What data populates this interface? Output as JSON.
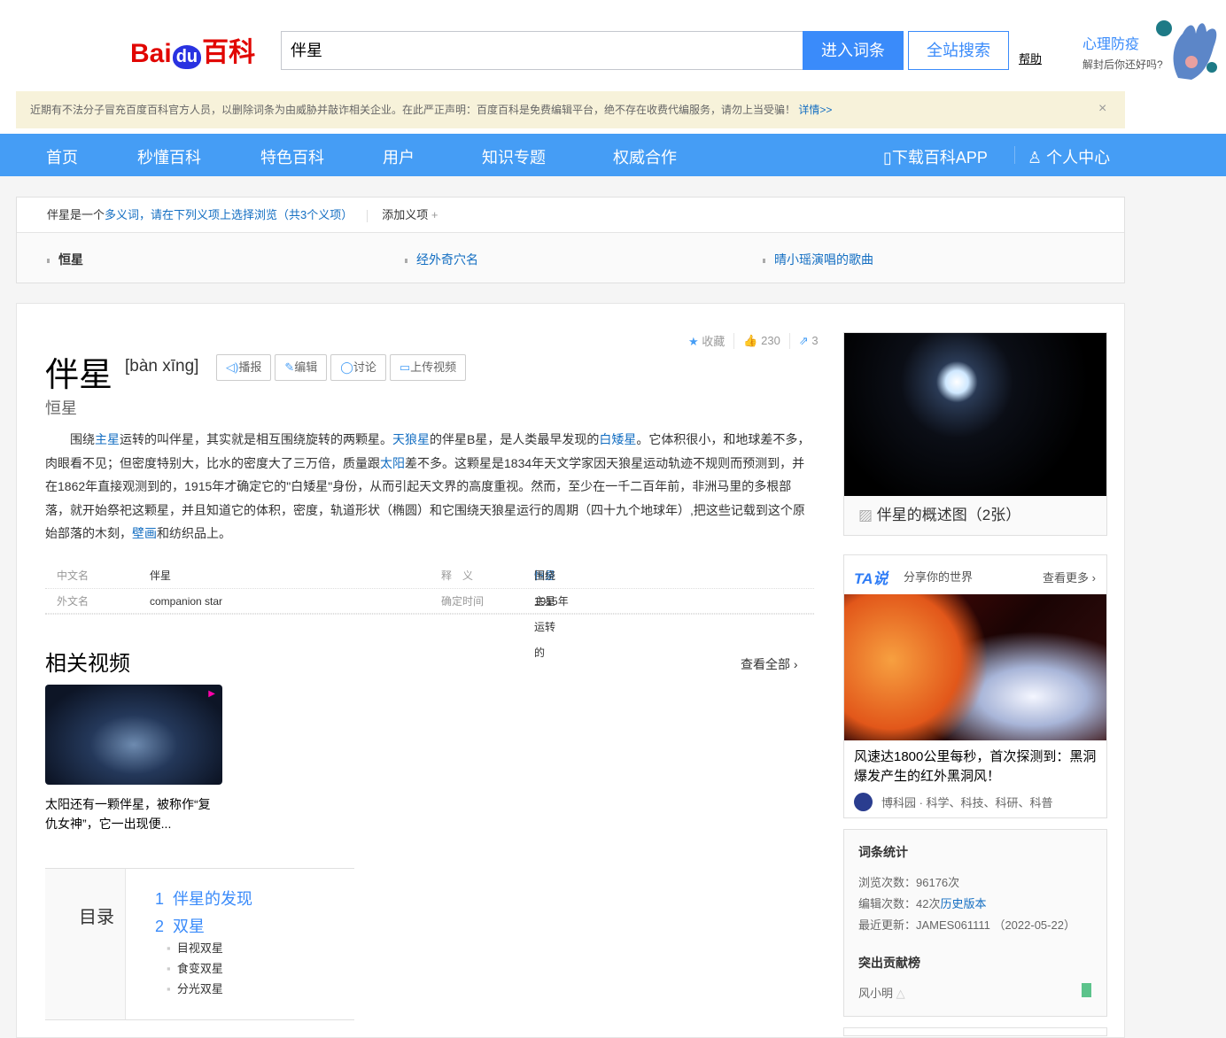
{
  "header": {
    "logo_text": "Baidu百科",
    "logo_parts": [
      "Bai",
      "du",
      "百科"
    ],
    "search_value": "伴星",
    "enter_button": "进入词条",
    "site_search_button": "全站搜索",
    "help_link": "帮助",
    "promo_title": "心理防疫",
    "promo_subtitle": "解封后你还好吗?"
  },
  "notice": {
    "text": "近期有不法分子冒充百度百科官方人员，以删除词条为由威胁并敲诈相关企业。在此严正声明：百度百科是免费编辑平台，绝不存在收费代编服务，请勿上当受骗！",
    "link": "详情>>",
    "close": "×"
  },
  "nav": {
    "items": [
      "首页",
      "秒懂百科",
      "特色百科",
      "用户",
      "知识专题",
      "权威合作"
    ],
    "app": "下载百科APP",
    "personal": "个人中心"
  },
  "polysemy": {
    "term": "伴星",
    "pre": "是一个",
    "link": "多义词",
    "mid": "，请在下列义项上选择浏览（共3个义项）",
    "add": "添加义项",
    "add_icon": "+",
    "items": [
      "恒星",
      "经外奇穴名",
      "晴小瑶演唱的歌曲"
    ]
  },
  "entry": {
    "title": "伴星",
    "pinyin": "[bàn xīng]",
    "subtitle": "恒星",
    "tools": [
      "播报",
      "编辑",
      "讨论",
      "上传视频"
    ],
    "collect": "收藏",
    "likes": "230",
    "shares": "3",
    "para": [
      {
        "t": "围绕"
      },
      {
        "l": "主星"
      },
      {
        "t": "运转的叫伴星，其实就是相互围绕旋转的两颗星。"
      },
      {
        "l": "天狼星"
      },
      {
        "t": "的伴星B星，是人类最早发现的"
      },
      {
        "l": "白矮星"
      },
      {
        "t": "。它体积很小，和地球差不多，肉眼看不见；但密度特别大，比水的密度大了三万倍，质量跟"
      },
      {
        "l": "太阳"
      },
      {
        "t": "差不多。这颗星是1834年天文学家因天狼星运动轨迹不规则而预测到，并在1862年直接观测到的，1915年才确定它的\"白矮星\"身份，从而引起天文界的高度重视。然而，至少在一千二百年前，非洲马里的多根部落，就开始祭祀这颗星，并且知道它的体积，密度，轨道形状（椭圆）和它围绕天狼星运行的周期（四十九个地球年）,把这些记载到这个原始部落的木刻，"
      },
      {
        "l": "壁画"
      },
      {
        "t": "和纺织品上。"
      }
    ],
    "info": [
      {
        "k": "中文名",
        "v": "伴星",
        "k2": "释　义",
        "v2": "围绕主星运转的",
        "v2link": "恒星"
      },
      {
        "k": "外文名",
        "v": "companion star",
        "k2": "确定时间",
        "v2": "1915年",
        "v2link": ""
      }
    ]
  },
  "videos": {
    "title": "相关视频",
    "more": "查看全部 ›",
    "items": [
      {
        "caption": "太阳还有一颗伴星，被称作“复仇女神”，它一出现便..."
      }
    ]
  },
  "toc": {
    "title": "目录",
    "items": [
      {
        "num": "1",
        "label": "伴星的发现"
      },
      {
        "num": "2",
        "label": "双星"
      }
    ],
    "sub": [
      "目视双星",
      "食变双星",
      "分光双星"
    ]
  },
  "sidebar": {
    "album_caption": "伴星的概述图（2张）",
    "ta": {
      "brand": "TA说",
      "slogan": "分享你的世界",
      "more": "查看更多 ›",
      "headline": "风速达1800公里每秒，首次探测到：黑洞爆发产生的红外黑洞风！",
      "author": "博科园 · 科学、科技、科研、科普"
    },
    "stats": {
      "title": "词条统计",
      "views_label": "浏览次数：",
      "views": "96176次",
      "edits_label": "编辑次数：",
      "edits": "42次",
      "history": "历史版本",
      "updated_label": "最近更新：",
      "updated": "JAMES061111 （2022-05-22）",
      "contrib_title": "突出贡献榜",
      "contributor": "风小明"
    }
  },
  "colors": {
    "brand_blue": "#459df5",
    "link": "#136ec2",
    "notice_bg": "#f7f2da"
  }
}
